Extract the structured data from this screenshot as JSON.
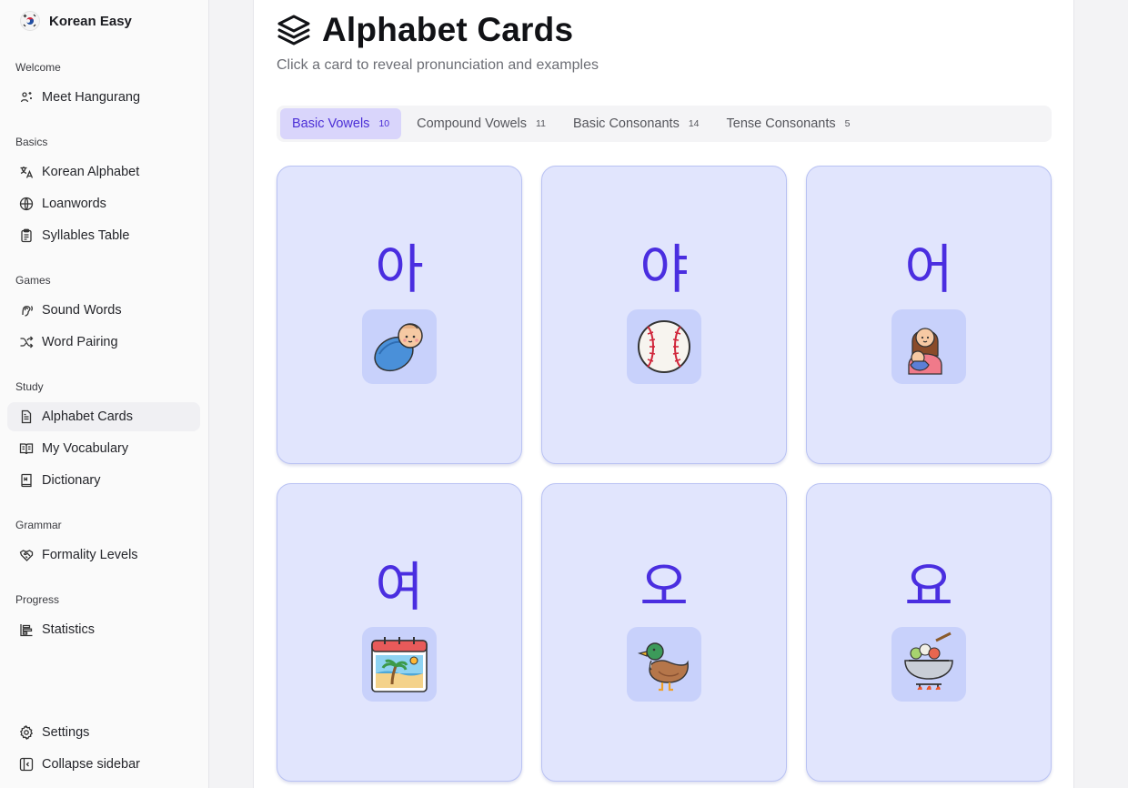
{
  "app": {
    "name": "Korean Easy"
  },
  "sidebar": {
    "sections": [
      {
        "label": "Welcome",
        "items": [
          {
            "label": "Meet Hangurang",
            "icon": "sparkle-person-icon"
          }
        ]
      },
      {
        "label": "Basics",
        "items": [
          {
            "label": "Korean Alphabet",
            "icon": "translate-icon"
          },
          {
            "label": "Loanwords",
            "icon": "globe-icon"
          },
          {
            "label": "Syllables Table",
            "icon": "clipboard-icon"
          }
        ]
      },
      {
        "label": "Games",
        "items": [
          {
            "label": "Sound Words",
            "icon": "ear-icon"
          },
          {
            "label": "Word Pairing",
            "icon": "shuffle-icon"
          }
        ]
      },
      {
        "label": "Study",
        "items": [
          {
            "label": "Alphabet Cards",
            "icon": "file-text-icon",
            "active": true
          },
          {
            "label": "My Vocabulary",
            "icon": "book-open-icon"
          },
          {
            "label": "Dictionary",
            "icon": "book-icon"
          }
        ]
      },
      {
        "label": "Grammar",
        "items": [
          {
            "label": "Formality Levels",
            "icon": "handshake-icon"
          }
        ]
      },
      {
        "label": "Progress",
        "items": [
          {
            "label": "Statistics",
            "icon": "bar-chart-icon"
          }
        ]
      }
    ],
    "footer": [
      {
        "label": "Settings",
        "icon": "gear-icon"
      },
      {
        "label": "Collapse sidebar",
        "icon": "panel-collapse-icon"
      }
    ]
  },
  "main": {
    "title": "Alphabet Cards",
    "subtitle": "Click a card to reveal pronunciation and examples",
    "tabs": [
      {
        "label": "Basic Vowels",
        "count": "10",
        "active": true
      },
      {
        "label": "Compound Vowels",
        "count": "11"
      },
      {
        "label": "Basic Consonants",
        "count": "14"
      },
      {
        "label": "Tense Consonants",
        "count": "5"
      }
    ],
    "cards": [
      {
        "glyph": "아",
        "icon": "baby-icon"
      },
      {
        "glyph": "야",
        "icon": "baseball-icon"
      },
      {
        "glyph": "어",
        "icon": "mother-icon"
      },
      {
        "glyph": "여",
        "icon": "summer-calendar-icon"
      },
      {
        "glyph": "오",
        "icon": "duck-icon"
      },
      {
        "glyph": "요",
        "icon": "cooking-pot-icon"
      }
    ]
  },
  "colors": {
    "accent": "#4a2ee0",
    "card_bg": "#e1e5fd",
    "card_border": "#b9c2f3",
    "tab_active_bg": "#d9d5fb"
  }
}
